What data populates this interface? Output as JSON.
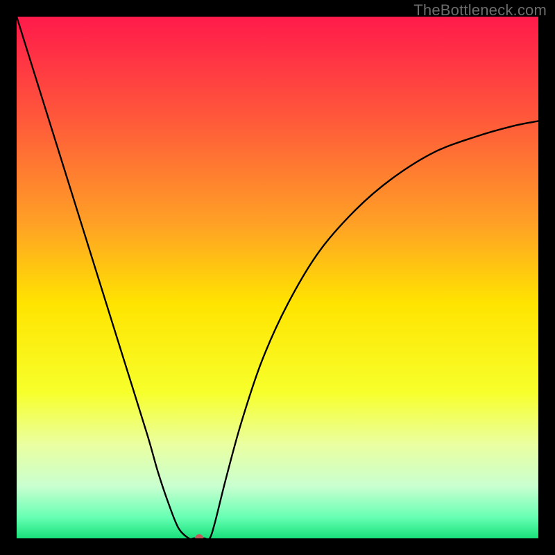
{
  "watermark": "TheBottleneck.com",
  "chart_data": {
    "type": "line",
    "title": "",
    "xlabel": "",
    "ylabel": "",
    "xlim": [
      0,
      100
    ],
    "ylim": [
      0,
      100
    ],
    "grid": false,
    "legend": false,
    "background_gradient": {
      "stops": [
        {
          "offset": 0.0,
          "color": "#ff1a4b"
        },
        {
          "offset": 0.2,
          "color": "#ff5a3a"
        },
        {
          "offset": 0.4,
          "color": "#ffa225"
        },
        {
          "offset": 0.55,
          "color": "#ffe400"
        },
        {
          "offset": 0.72,
          "color": "#f7ff2b"
        },
        {
          "offset": 0.82,
          "color": "#eaffa0"
        },
        {
          "offset": 0.9,
          "color": "#c9ffd0"
        },
        {
          "offset": 0.96,
          "color": "#66ffb3"
        },
        {
          "offset": 1.0,
          "color": "#18e07a"
        }
      ]
    },
    "series": [
      {
        "name": "bottleneck-curve",
        "color": "#000000",
        "x": [
          0,
          5,
          10,
          15,
          20,
          25,
          27,
          29,
          31,
          33,
          34,
          35,
          36,
          37,
          38,
          40,
          43,
          47,
          52,
          58,
          65,
          72,
          80,
          88,
          95,
          100
        ],
        "y": [
          100,
          84,
          68,
          52,
          36,
          20,
          13,
          7,
          2,
          0,
          0,
          0,
          0,
          0,
          3,
          11,
          22,
          34,
          45,
          55,
          63,
          69,
          74,
          77,
          79,
          80
        ]
      }
    ],
    "marker": {
      "name": "min-point",
      "x": 35,
      "y": 0,
      "color": "#c05a5a",
      "radius_px": 6
    }
  }
}
